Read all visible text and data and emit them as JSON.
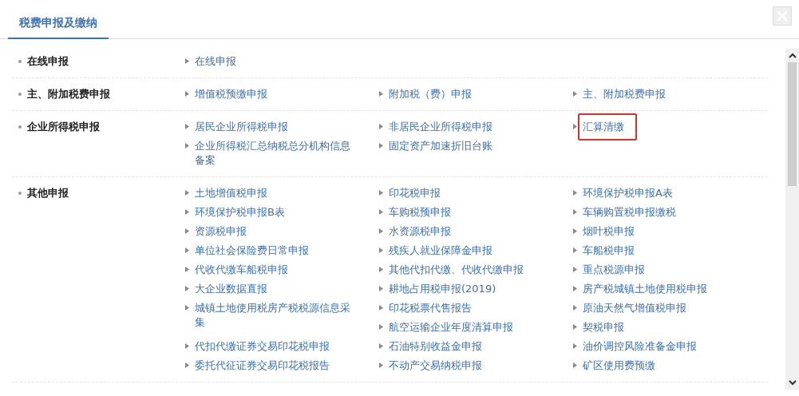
{
  "dialog": {
    "title": "税费申报及缴纳",
    "tab_selected": true
  },
  "sections": [
    {
      "label": "在线申报",
      "links": [
        {
          "text": "在线申报",
          "highlighted": false
        }
      ]
    },
    {
      "label": "主、附加税费申报",
      "links": [
        {
          "text": "增值税预缴申报",
          "highlighted": false
        },
        {
          "text": "附加税（费）申报",
          "highlighted": false
        },
        {
          "text": "主、附加税费申报",
          "highlighted": false
        }
      ]
    },
    {
      "label": "企业所得税申报",
      "links": [
        {
          "text": "居民企业所得税申报",
          "highlighted": false
        },
        {
          "text": "非居民企业所得税申报",
          "highlighted": false
        },
        {
          "text": "汇算清缴",
          "highlighted": true
        },
        {
          "text": "企业所得税汇总纳税总分机构信息备案",
          "highlighted": false
        },
        {
          "text": "固定资产加速折旧台账",
          "highlighted": false
        }
      ]
    },
    {
      "label": "其他申报",
      "links": [
        {
          "text": "土地增值税申报",
          "highlighted": false
        },
        {
          "text": "印花税申报",
          "highlighted": false
        },
        {
          "text": "环境保护税申报A表",
          "highlighted": false
        },
        {
          "text": "环境保护税申报B表",
          "highlighted": false
        },
        {
          "text": "车购税预申报",
          "highlighted": false
        },
        {
          "text": "车辆购置税申报缴税",
          "highlighted": false
        },
        {
          "text": "资源税申报",
          "highlighted": false
        },
        {
          "text": "水资源税申报",
          "highlighted": false
        },
        {
          "text": "烟叶税申报",
          "highlighted": false
        },
        {
          "text": "单位社会保险费日常申报",
          "highlighted": false
        },
        {
          "text": "残疾人就业保障金申报",
          "highlighted": false
        },
        {
          "text": "车船税申报",
          "highlighted": false
        },
        {
          "text": "代收代缴车船税申报",
          "highlighted": false
        },
        {
          "text": "其他代扣代缴、代收代缴申报",
          "highlighted": false
        },
        {
          "text": "重点税源申报",
          "highlighted": false
        },
        {
          "text": "大企业数据直报",
          "highlighted": false
        },
        {
          "text": "耕地占用税申报(2019)",
          "highlighted": false
        },
        {
          "text": "房产税城镇土地使用税申报",
          "highlighted": false
        },
        {
          "text": "城镇土地使用税房产税税源信息采集",
          "highlighted": false
        },
        {
          "text": "印花税票代售报告",
          "highlighted": false
        },
        {
          "text": "原油天然气增值税申报",
          "highlighted": false
        },
        {
          "text": "航空运输企业年度清算申报",
          "highlighted": false
        },
        {
          "text": "契税申报",
          "highlighted": false
        },
        {
          "text": "代扣代缴证券交易印花税申报",
          "highlighted": false
        },
        {
          "text": "石油特别收益金申报",
          "highlighted": false
        },
        {
          "text": "油价调控风险准备金申报",
          "highlighted": false
        },
        {
          "text": "委托代征证券交易印花税报告",
          "highlighted": false
        },
        {
          "text": "不动产交易纳税申报",
          "highlighted": false
        },
        {
          "text": "矿区使用费预缴",
          "highlighted": false
        }
      ]
    }
  ]
}
